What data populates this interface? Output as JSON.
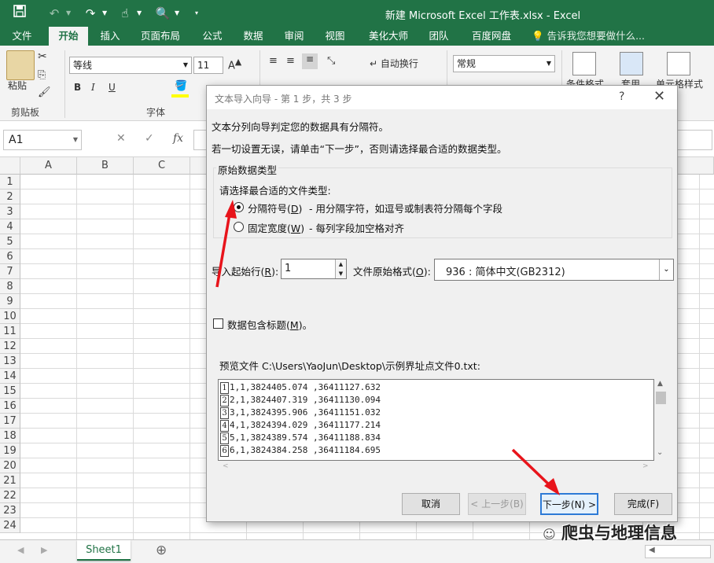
{
  "window": {
    "title": "新建 Microsoft Excel 工作表.xlsx  -  Excel",
    "accent": "#217346"
  },
  "quick_access": {
    "save_icon": "save-icon",
    "undo_icon": "undo-icon",
    "redo_icon": "redo-icon",
    "touch_icon": "touch-mode-icon",
    "preview_icon": "print-preview-icon"
  },
  "ribbon_tabs": [
    "文件",
    "开始",
    "插入",
    "页面布局",
    "公式",
    "数据",
    "审阅",
    "视图",
    "美化大师",
    "团队",
    "百度网盘"
  ],
  "active_tab": "开始",
  "tell_me": "告诉我您想要做什么...",
  "ribbon": {
    "paste_label": "粘贴",
    "clipboard_group": "剪贴板",
    "font_name": "等线",
    "font_size": "11",
    "bold": "B",
    "italic": "I",
    "underline": "U",
    "font_group": "字体",
    "wrap_text": "自动换行",
    "number_format": "常规",
    "conditional_format": "条件格式",
    "table_format": "套用",
    "cell_style": "单元格样式"
  },
  "formula_bar": {
    "name_box": "A1",
    "cancel_symbol": "✕",
    "enter_symbol": "✓",
    "fx_label": "fx",
    "formula": ""
  },
  "grid": {
    "columns": [
      "A",
      "B",
      "C"
    ],
    "rows": [
      "1",
      "2",
      "3",
      "4",
      "5",
      "6",
      "7",
      "8",
      "9",
      "10",
      "11",
      "12",
      "13",
      "14",
      "15",
      "16",
      "17",
      "18",
      "19",
      "20",
      "21",
      "22",
      "23",
      "24"
    ]
  },
  "sheet_tabs": {
    "sheet1": "Sheet1",
    "add_icon": "plus-circle-icon"
  },
  "dialog": {
    "title": "文本导入向导 - 第 1 步，共 3 步",
    "help": "?",
    "close": "✕",
    "line1": "文本分列向导判定您的数据具有分隔符。",
    "line2": "若一切设置无误，请单击“下一步”，否则请选择最合适的数据类型。",
    "group_title": "原始数据类型",
    "choose_prompt": "请选择最合适的文件类型:",
    "option_delimited_label": "分隔符号(",
    "option_delimited_key": "D",
    "option_delimited_desc": "- 用分隔字符，如逗号或制表符分隔每个字段",
    "option_fixed_label": "固定宽度(",
    "option_fixed_key": "W",
    "option_fixed_desc": "- 每列字段加空格对齐",
    "start_row_label": "导入起始行(",
    "start_row_key": "R",
    "start_row_value": "1",
    "origin_label": "文件原始格式(",
    "origin_key": "O",
    "origin_value": "936 : 简体中文(GB2312)",
    "header_checkbox_label": "数据包含标题(",
    "header_checkbox_key": "M",
    "preview_label": "预览文件 C:\\Users\\YaoJun\\Desktop\\示例界址点文件0.txt:",
    "preview_rows": [
      {
        "n": "1",
        "text": "1,1,3824405.074 ,36411127.632"
      },
      {
        "n": "2",
        "text": "2,1,3824407.319 ,36411130.094"
      },
      {
        "n": "3",
        "text": "3,1,3824395.906 ,36411151.032"
      },
      {
        "n": "4",
        "text": "4,1,3824394.029 ,36411177.214"
      },
      {
        "n": "5",
        "text": "5,1,3824389.574 ,36411188.834"
      },
      {
        "n": "6",
        "text": "6,1,3824384.258 ,36411184.695"
      }
    ],
    "buttons": {
      "cancel": "取消",
      "back": "< 上一步(B)",
      "next": "下一步(N) >",
      "finish": "完成(F)"
    }
  },
  "watermark": "爬虫与地理信息"
}
